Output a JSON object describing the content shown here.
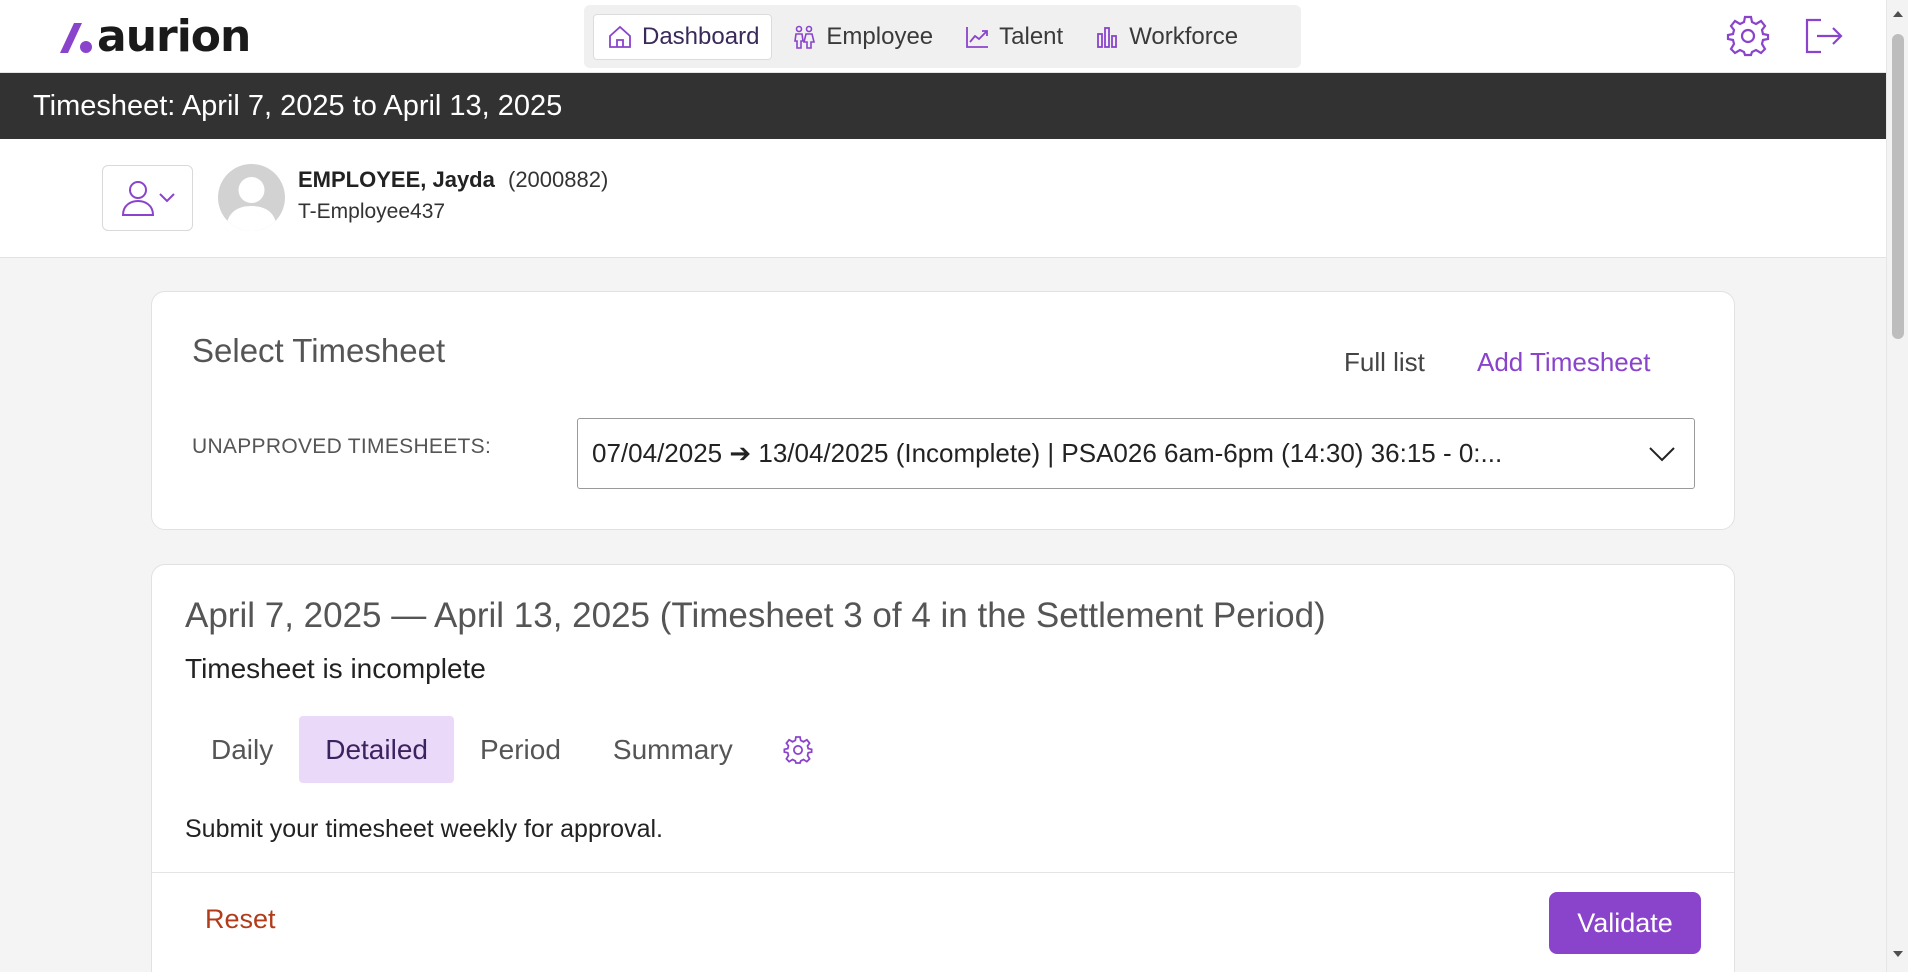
{
  "brand": {
    "name": "aurion",
    "accent": "#8a44cc"
  },
  "nav": {
    "items": [
      {
        "label": "Dashboard",
        "icon": "home-icon",
        "active": true
      },
      {
        "label": "Employee",
        "icon": "people-icon",
        "active": false
      },
      {
        "label": "Talent",
        "icon": "trend-chart-icon",
        "active": false
      },
      {
        "label": "Workforce",
        "icon": "bar-chart-icon",
        "active": false
      }
    ],
    "right_icons": [
      "settings-gear-icon",
      "logout-icon"
    ]
  },
  "titlebar": {
    "title": "Timesheet: April 7, 2025 to April 13, 2025"
  },
  "employee": {
    "name": "EMPLOYEE, Jayda",
    "id": "(2000882)",
    "code": "T-Employee437"
  },
  "select_timesheet": {
    "title": "Select Timesheet",
    "full_list_label": "Full list",
    "add_label": "Add Timesheet",
    "unapproved_label": "UNAPPROVED TIMESHEETS:",
    "selected_value": "07/04/2025 ➔ 13/04/2025 (Incomplete) | PSA026 6am-6pm (14:30) 36:15 - 0:..."
  },
  "timesheet": {
    "period_title": "April 7, 2025 — April 13, 2025 (Timesheet 3 of 4 in the Settlement Period)",
    "status": "Timesheet is incomplete",
    "tabs": [
      {
        "label": "Daily",
        "active": false
      },
      {
        "label": "Detailed",
        "active": true
      },
      {
        "label": "Period",
        "active": false
      },
      {
        "label": "Summary",
        "active": false
      }
    ],
    "note": "Submit your timesheet weekly for approval.",
    "reset_label": "Reset",
    "validate_label": "Validate"
  }
}
